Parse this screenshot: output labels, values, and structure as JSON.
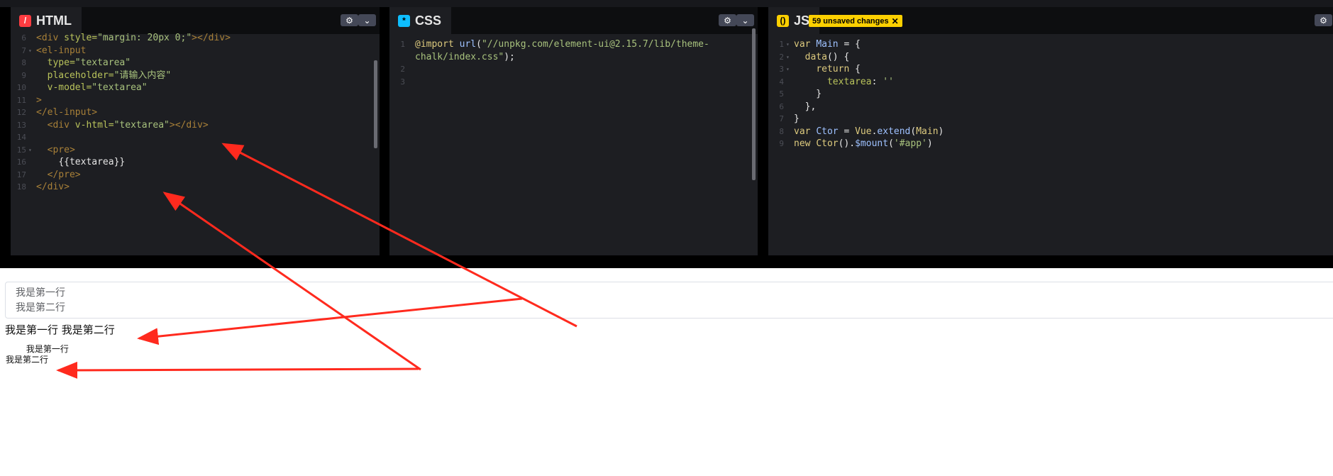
{
  "html_panel": {
    "title": "HTML",
    "icon": "slash-icon",
    "lines": [
      {
        "n": "6",
        "parts": [
          [
            "tag",
            "<div "
          ],
          [
            "attr",
            "style="
          ],
          [
            "str",
            "\"margin: 20px 0;\""
          ],
          [
            "tag",
            "></div>"
          ]
        ]
      },
      {
        "n": "7",
        "fold": true,
        "parts": [
          [
            "tag",
            "<el-input"
          ]
        ]
      },
      {
        "n": "8",
        "parts": [
          [
            "plain",
            "  "
          ],
          [
            "attr",
            "type="
          ],
          [
            "str",
            "\"textarea\""
          ]
        ]
      },
      {
        "n": "9",
        "parts": [
          [
            "plain",
            "  "
          ],
          [
            "attr",
            "placeholder="
          ],
          [
            "str",
            "\"请输入内容\""
          ]
        ]
      },
      {
        "n": "10",
        "parts": [
          [
            "plain",
            "  "
          ],
          [
            "attr",
            "v-model="
          ],
          [
            "str",
            "\"textarea\""
          ]
        ]
      },
      {
        "n": "11",
        "parts": [
          [
            "tag",
            ">"
          ]
        ]
      },
      {
        "n": "12",
        "parts": [
          [
            "tag",
            "</el-input>"
          ]
        ]
      },
      {
        "n": "13",
        "parts": [
          [
            "plain",
            "  "
          ],
          [
            "tag",
            "<div "
          ],
          [
            "attr",
            "v-html="
          ],
          [
            "str",
            "\"textarea\""
          ],
          [
            "tag",
            "></div>"
          ]
        ]
      },
      {
        "n": "14",
        "parts": []
      },
      {
        "n": "15",
        "fold": true,
        "parts": [
          [
            "plain",
            "  "
          ],
          [
            "tag",
            "<pre>"
          ]
        ]
      },
      {
        "n": "16",
        "parts": [
          [
            "plain",
            "    "
          ],
          [
            "txt",
            "{{textarea}}"
          ]
        ]
      },
      {
        "n": "17",
        "parts": [
          [
            "plain",
            "  "
          ],
          [
            "tag",
            "</pre>"
          ]
        ]
      },
      {
        "n": "18",
        "parts": [
          [
            "tag",
            "</div>"
          ]
        ]
      }
    ]
  },
  "css_panel": {
    "title": "CSS",
    "icon": "asterisk-icon",
    "lines": [
      {
        "n": "1",
        "parts": [
          [
            "kw",
            "@import "
          ],
          [
            "var",
            "url"
          ],
          [
            "plain",
            "("
          ],
          [
            "str",
            "\"//unpkg.com/element-ui@2.15.7/lib/theme-"
          ]
        ]
      },
      {
        "n": "",
        "parts": [
          [
            "str",
            "chalk/index.css\""
          ],
          [
            "plain",
            ");"
          ]
        ]
      },
      {
        "n": "2",
        "parts": []
      },
      {
        "n": "3",
        "parts": []
      }
    ]
  },
  "js_panel": {
    "title": "JS",
    "icon": "braces-icon",
    "unsaved_badge": "59 unsaved changes",
    "lines": [
      {
        "n": "1",
        "fold": true,
        "parts": [
          [
            "kw",
            "var "
          ],
          [
            "var",
            "Main"
          ],
          [
            "plain",
            " = {"
          ]
        ]
      },
      {
        "n": "2",
        "fold": true,
        "parts": [
          [
            "plain",
            "  "
          ],
          [
            "fn",
            "data"
          ],
          [
            "plain",
            "() {"
          ]
        ]
      },
      {
        "n": "3",
        "fold": true,
        "parts": [
          [
            "plain",
            "    "
          ],
          [
            "kw",
            "return"
          ],
          [
            "plain",
            " {"
          ]
        ]
      },
      {
        "n": "4",
        "parts": [
          [
            "plain",
            "      "
          ],
          [
            "attr",
            "textarea"
          ],
          [
            "plain",
            ": "
          ],
          [
            "str",
            "''"
          ]
        ]
      },
      {
        "n": "5",
        "parts": [
          [
            "plain",
            "    }"
          ]
        ]
      },
      {
        "n": "6",
        "parts": [
          [
            "plain",
            "  },"
          ]
        ]
      },
      {
        "n": "7",
        "parts": [
          [
            "plain",
            "}"
          ]
        ]
      },
      {
        "n": "8",
        "parts": [
          [
            "kw",
            "var "
          ],
          [
            "var",
            "Ctor"
          ],
          [
            "plain",
            " = "
          ],
          [
            "fn",
            "Vue"
          ],
          [
            "plain",
            "."
          ],
          [
            "var",
            "extend"
          ],
          [
            "plain",
            "("
          ],
          [
            "fn",
            "Main"
          ],
          [
            "plain",
            ")"
          ]
        ]
      },
      {
        "n": "9",
        "parts": [
          [
            "kw",
            "new "
          ],
          [
            "fn",
            "Ctor"
          ],
          [
            "plain",
            "()."
          ],
          [
            "var",
            "$mount"
          ],
          [
            "plain",
            "("
          ],
          [
            "str",
            "'#app'"
          ],
          [
            "plain",
            ")"
          ]
        ]
      }
    ]
  },
  "output": {
    "textarea_line1": "我是第一行",
    "textarea_line2": "我是第二行",
    "vhtml_text": "我是第一行 我是第二行",
    "pre_line1": "    我是第一行",
    "pre_line2": "我是第二行"
  },
  "colors": {
    "arrow": "#ff2a1e",
    "panel_bg": "#1d1e22",
    "badge": "#fcd000"
  }
}
